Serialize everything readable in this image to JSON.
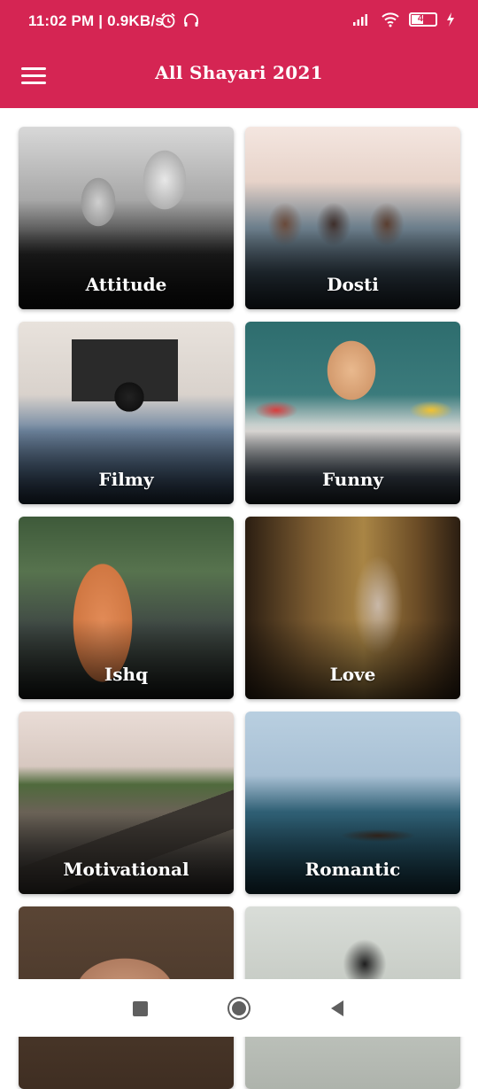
{
  "status_bar": {
    "time_speed": "11:02 PM | 0.9KB/s",
    "battery": "40"
  },
  "app_bar": {
    "title": "All Shayari 2021"
  },
  "categories": [
    {
      "label": "Attitude"
    },
    {
      "label": "Dosti"
    },
    {
      "label": "Filmy"
    },
    {
      "label": "Funny"
    },
    {
      "label": "Ishq"
    },
    {
      "label": "Love"
    },
    {
      "label": "Motivational"
    },
    {
      "label": "Romantic"
    },
    {
      "label": ""
    },
    {
      "label": ""
    }
  ],
  "colors": {
    "primary": "#d52553",
    "background": "#ffffff"
  },
  "nav_icons": [
    "square-recents-icon",
    "circle-home-icon",
    "triangle-back-icon"
  ]
}
